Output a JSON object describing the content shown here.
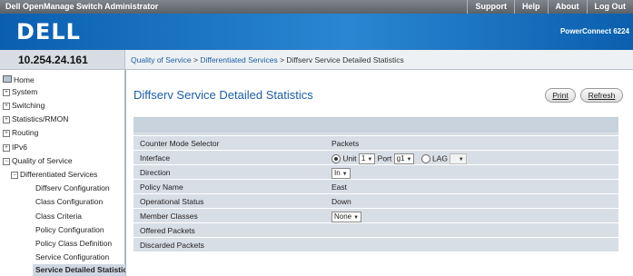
{
  "header": {
    "app_title": "Dell OpenManage Switch Administrator",
    "links": [
      "Support",
      "Help",
      "About",
      "Log Out"
    ],
    "logo": "DELL",
    "product": "PowerConnect 6224"
  },
  "ip_address": "10.254.24.161",
  "breadcrumb": {
    "items": [
      "Quality of Service",
      "Differentiated Services",
      "Diffserv Service Detailed Statistics"
    ],
    "separator": ">"
  },
  "sidebar": {
    "home": "Home",
    "system": "System",
    "switching": "Switching",
    "statistics": "Statistics/RMON",
    "routing": "Routing",
    "ipv6": "IPv6",
    "qos": "Quality of Service",
    "diffserv": "Differentiated Services",
    "diffserv_config": "Diffserv Configuration",
    "class_config": "Class Configuration",
    "class_criteria": "Class Criteria",
    "policy_config": "Policy Configuration",
    "policy_class_def": "Policy Class Definition",
    "service_config": "Service Configuration",
    "service_stats": "Service Detailed Statistics"
  },
  "main": {
    "title": "Diffserv Service Detailed Statistics",
    "print_label": "Print",
    "refresh_label": "Refresh"
  },
  "form": {
    "counter_mode_label": "Counter Mode Selector",
    "counter_mode_value": "Packets",
    "interface_label": "Interface",
    "unit_label": "Unit",
    "unit_value": "1",
    "port_label": "Port",
    "port_value": "g1",
    "lag_label": "LAG",
    "lag_value": "",
    "direction_label": "Direction",
    "direction_value": "In",
    "policy_name_label": "Policy Name",
    "policy_name_value": "East",
    "operational_status_label": "Operational Status",
    "operational_status_value": "Down",
    "member_classes_label": "Member Classes",
    "member_classes_value": "None",
    "offered_packets_label": "Offered Packets",
    "offered_packets_value": "",
    "discarded_packets_label": "Discarded Packets",
    "discarded_packets_value": ""
  },
  "colors": {
    "banner_blue": "#1e74c3",
    "title_blue": "#1c5ea6",
    "panel_bg": "#d8dee6"
  }
}
